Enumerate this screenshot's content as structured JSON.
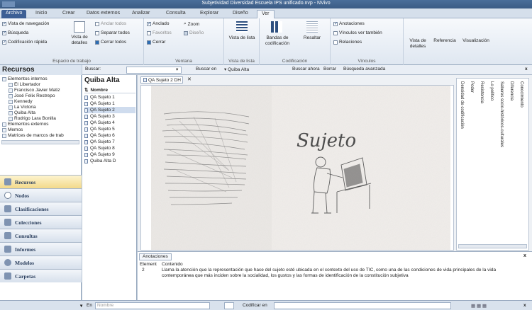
{
  "window": {
    "title": "Subjetividad Diversidad Escuela IPS unificado.nvp - NVivo"
  },
  "ribbon_tabs": [
    "Archivo",
    "Inicio",
    "Crear",
    "Datos externos",
    "Analizar",
    "Consulta",
    "Explorar",
    "Diseño",
    "Ver"
  ],
  "ribbon": {
    "espacio": {
      "label": "Espacio de trabajo",
      "vista_navegacion": "Vista de navegación",
      "busqueda": "Búsqueda",
      "codificacion_rapida": "Codificación rápida",
      "vista_detalles": "Vista de detalles",
      "anclar_todos": "Anclar todos",
      "separar_todos": "Separar todos",
      "cerrar_todos": "Cerrar todos"
    },
    "ventana": {
      "label": "Ventana",
      "anclado": "Anclado",
      "zoom": "Zoom",
      "favoritos": "Favoritos",
      "diseno": "Diseño",
      "cerrar": "Cerrar"
    },
    "vista_lista": {
      "label": "Vista de lista",
      "btn": "Vista de lista"
    },
    "codificacion": {
      "label": "Codificación",
      "bandas": "Bandas de codificación",
      "resaltar": "Resaltar"
    },
    "vinculos": {
      "label": "Vínculos",
      "anotaciones": "Anotaciones",
      "vinculos_ver": "Vínculos ver también",
      "relaciones": "Relaciones"
    },
    "extra": {
      "vista_detalles": "Vista de detalles",
      "referencia": "Referencia",
      "visualizacion": "Visualización"
    }
  },
  "nav": {
    "header": "Recursos",
    "tree": [
      "Elementos internos",
      "El Libertador",
      "Francisco Javier Matiz",
      "José Felix Restrepo",
      "Kennedy",
      "La Victoria",
      "Quiba Alta",
      "Rodrigo Lara Bonilla",
      "Elementos externos",
      "Memos",
      "Matrices de marcos de trab"
    ],
    "buttons": [
      "Recursos",
      "Nodos",
      "Clasificaciones",
      "Colecciones",
      "Consultas",
      "Informes",
      "Modelos",
      "Carpetas"
    ]
  },
  "search": {
    "label": "Buscar:",
    "buscar_en": "Buscar en",
    "scope": "Quiba Alta",
    "buscar_ahora": "Buscar ahora",
    "borrar": "Borrar",
    "avanzada": "Búsqueda avanzada"
  },
  "list": {
    "title": "Quiba Alta",
    "column": "Nombre",
    "items": [
      "QA Sujeto 1",
      "QA Sujeto 1",
      "QA Sujeto 2",
      "QA Sujeto 3",
      "QA Sujeto 4",
      "QA Sujeto 5",
      "QA Sujeto 6",
      "QA Sujeto 7",
      "QA Sujeto 8",
      "QA Sujeto 9",
      "Quiba Alta D"
    ],
    "selected_index": 2
  },
  "document": {
    "tab": "QA Sujeto 2 DH",
    "drawing_word": "Sujeto"
  },
  "coding_stripes": [
    "Densidad de codificación",
    "Poder",
    "Resistencia",
    "Lo político",
    "Saberes socio-históricos-culturales",
    "Diferencia",
    "Conocimiento"
  ],
  "annotations": {
    "tab": "Anotaciones",
    "col_element": "Element",
    "col_content": "Contenido",
    "rows": [
      {
        "element": "2",
        "content": "Llama la atención que la representación que hace del sujeto esté ubicada en el contexto del uso de TIC, como una de las condiciones de vida principales de la vida contemporánea que más inciden sobre la socialidad, los gustos y las formas de identificación de la constitución subjetiva"
      }
    ]
  },
  "status": {
    "en": "En",
    "nombre": "Nombre",
    "codificar_en": "Codificar en"
  }
}
